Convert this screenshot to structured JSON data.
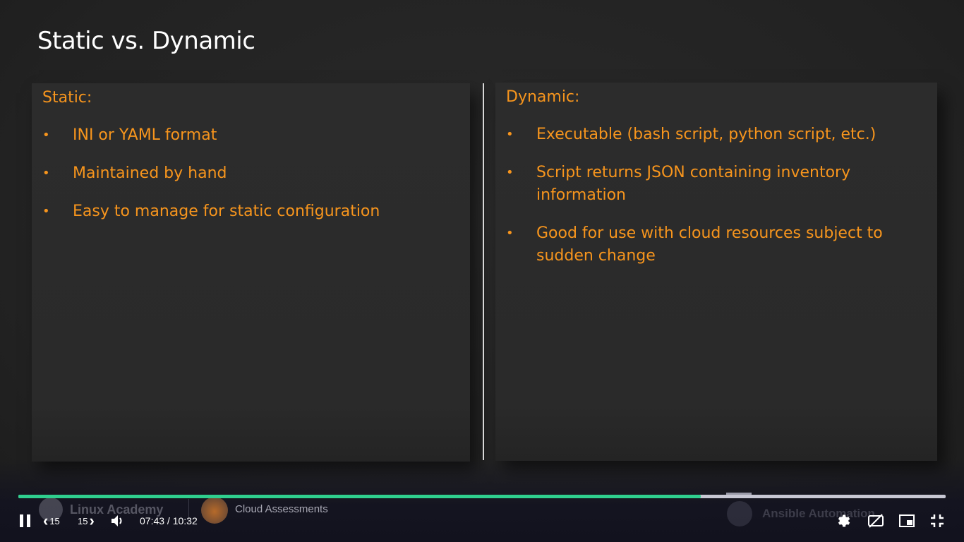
{
  "slide": {
    "title": "Static vs. Dynamic",
    "left_panel": {
      "heading": "Static:",
      "bullets": [
        "INI or YAML format",
        "Maintained by hand",
        "Easy to manage for static configuration"
      ]
    },
    "right_panel": {
      "heading": "Dynamic:",
      "bullets": [
        "Executable (bash script, python script, etc.)",
        "Script returns JSON containing inventory information",
        "Good for use with cloud resources subject to sudden change"
      ]
    }
  },
  "player": {
    "progress_fraction": 0.736,
    "skip_back_label": "15",
    "skip_forward_label": "15",
    "time": "07:43 / 10:32",
    "accent_color": "#2fcf8e"
  },
  "watermarks": {
    "left_brand": "Linux Academy",
    "middle_label": "Cloud Assessments",
    "right_label": "Ansible Automation"
  },
  "colors": {
    "bullet_text": "#f7951d",
    "title_text": "#ffffff"
  }
}
